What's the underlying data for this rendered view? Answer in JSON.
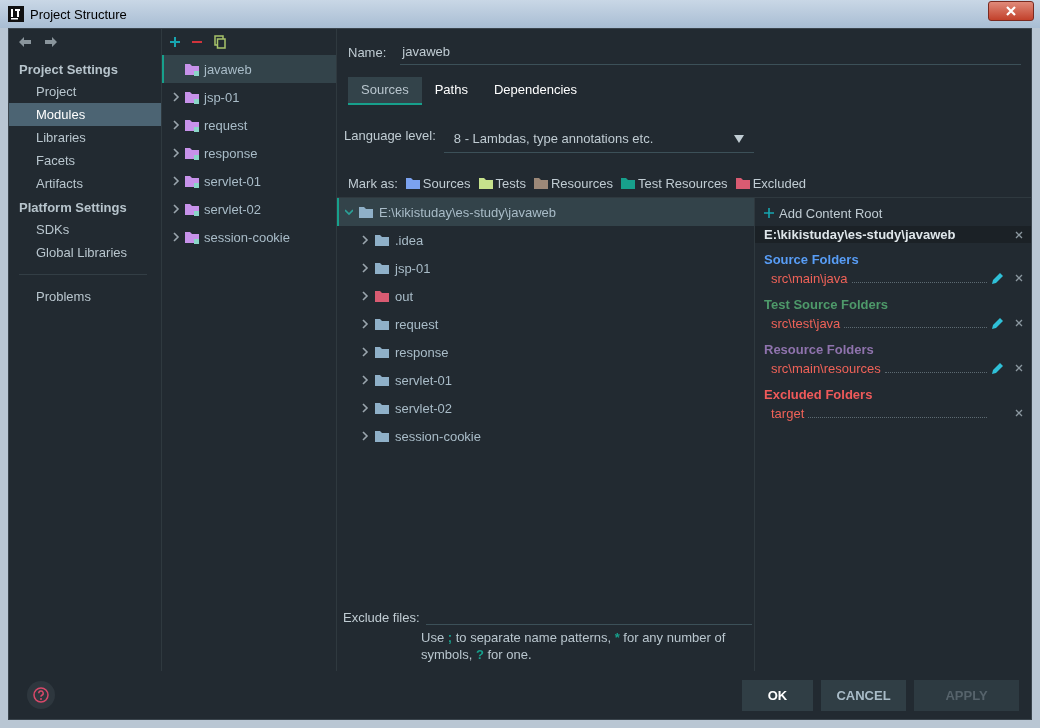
{
  "window": {
    "title": "Project Structure"
  },
  "nav": {
    "groups": [
      {
        "heading": "Project Settings",
        "items": [
          {
            "label": "Project",
            "selected": false
          },
          {
            "label": "Modules",
            "selected": true
          },
          {
            "label": "Libraries",
            "selected": false
          },
          {
            "label": "Facets",
            "selected": false
          },
          {
            "label": "Artifacts",
            "selected": false
          }
        ]
      },
      {
        "heading": "Platform Settings",
        "items": [
          {
            "label": "SDKs",
            "selected": false
          },
          {
            "label": "Global Libraries",
            "selected": false
          }
        ]
      }
    ],
    "extra_items": [
      {
        "label": "Problems",
        "selected": false
      }
    ]
  },
  "modules": {
    "items": [
      {
        "name": "javaweb",
        "expandable": false,
        "selected": true
      },
      {
        "name": "jsp-01",
        "expandable": true,
        "selected": false
      },
      {
        "name": "request",
        "expandable": true,
        "selected": false
      },
      {
        "name": "response",
        "expandable": true,
        "selected": false
      },
      {
        "name": "servlet-01",
        "expandable": true,
        "selected": false
      },
      {
        "name": "servlet-02",
        "expandable": true,
        "selected": false
      },
      {
        "name": "session-cookie",
        "expandable": true,
        "selected": false
      }
    ]
  },
  "name_field": {
    "label": "Name:",
    "value": "javaweb"
  },
  "tabs": [
    {
      "label": "Sources",
      "selected": true
    },
    {
      "label": "Paths",
      "selected": false
    },
    {
      "label": "Dependencies",
      "selected": false
    }
  ],
  "language_level": {
    "label": "Language level:",
    "value": "8 - Lambdas, type annotations etc."
  },
  "mark_as": {
    "label": "Mark as:",
    "items": [
      {
        "label": "Sources",
        "color": "#7ba2f0"
      },
      {
        "label": "Tests",
        "color": "#c6e28c"
      },
      {
        "label": "Resources",
        "color": "#9c8878"
      },
      {
        "label": "Test Resources",
        "color": "#17a08c"
      },
      {
        "label": "Excluded",
        "color": "#d95b72"
      }
    ]
  },
  "tree": {
    "root": {
      "label": "E:\\kikistuday\\es-study\\javaweb",
      "expanded": true,
      "selected": true,
      "children": [
        {
          "label": ".idea",
          "expanded": false,
          "excluded": false
        },
        {
          "label": "jsp-01",
          "expanded": false,
          "excluded": false
        },
        {
          "label": "out",
          "expanded": false,
          "excluded": true
        },
        {
          "label": "request",
          "expanded": false,
          "excluded": false
        },
        {
          "label": "response",
          "expanded": false,
          "excluded": false
        },
        {
          "label": "servlet-01",
          "expanded": false,
          "excluded": false
        },
        {
          "label": "servlet-02",
          "expanded": false,
          "excluded": false
        },
        {
          "label": "session-cookie",
          "expanded": false,
          "excluded": false
        }
      ]
    }
  },
  "exclude_files": {
    "label": "Exclude files:",
    "hint": "Use **;** to separate name patterns, ***** for any number of symbols, **?** for one."
  },
  "content_root": {
    "add_label": "Add Content Root",
    "path": "E:\\kikistuday\\es-study\\javaweb",
    "sections": [
      {
        "title": "Source Folders",
        "color": "#589df6",
        "folders": [
          {
            "path": "src\\main\\java",
            "editable": true
          }
        ]
      },
      {
        "title": "Test Source Folders",
        "color": "#4e9a6a",
        "folders": [
          {
            "path": "src\\test\\java",
            "editable": true
          }
        ]
      },
      {
        "title": "Resource Folders",
        "color": "#8f73ad",
        "folders": [
          {
            "path": "src\\main\\resources",
            "editable": true
          }
        ]
      },
      {
        "title": "Excluded Folders",
        "color": "#f05a5a",
        "folders": [
          {
            "path": "target",
            "editable": false
          }
        ]
      }
    ]
  },
  "buttons": [
    {
      "label": "OK",
      "disabled": false
    },
    {
      "label": "CANCEL",
      "disabled": false
    },
    {
      "label": "APPLY",
      "disabled": true
    }
  ]
}
